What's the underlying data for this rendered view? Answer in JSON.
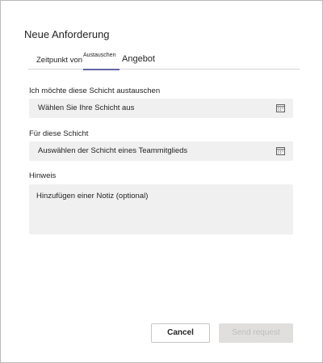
{
  "dialog": {
    "title": "Neue Anforderung"
  },
  "tabs": [
    {
      "label": "Zeitpunkt von"
    },
    {
      "label": "Austauschen",
      "selected": true
    },
    {
      "label": "Angebot"
    }
  ],
  "form": {
    "my_shift": {
      "label": "Ich möchte diese Schicht austauschen",
      "value": "Wählen Sie Ihre Schicht aus",
      "icon": "calendar-icon"
    },
    "their_shift": {
      "label": "Für diese Schicht",
      "value": "Auswählen der Schicht eines Teammitglieds",
      "icon": "calendar-icon"
    },
    "note": {
      "label": "Hinweis",
      "placeholder": "Hinzufügen einer Notiz (optional)"
    }
  },
  "actions": {
    "cancel_label": "Cancel",
    "send_label": "Send request"
  },
  "colors": {
    "accent": "#6264a7",
    "field_bg": "#f0f0f0",
    "disabled_bg": "#e1dfdd"
  }
}
